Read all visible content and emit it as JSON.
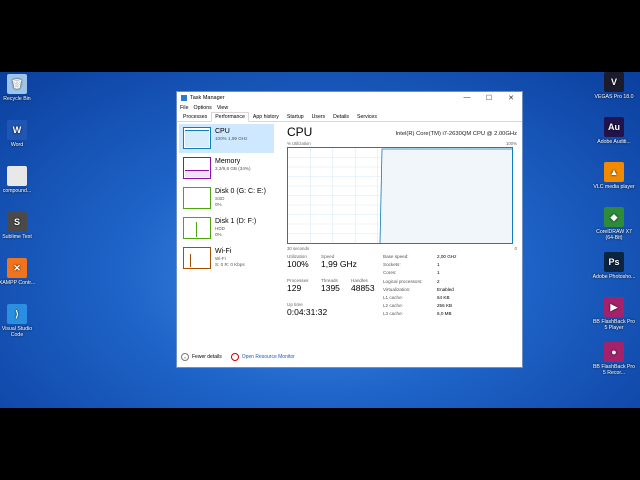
{
  "desktop": {
    "left_icons": [
      {
        "label": "Recycle Bin",
        "icon": "recycle-bin-icon",
        "color": "#9ec4e8",
        "glyph": "🗑"
      },
      {
        "label": "Word",
        "icon": "word-icon",
        "color": "#1f56b3",
        "glyph": "W"
      },
      {
        "label": "compound...",
        "icon": "document-icon",
        "color": "#e8e8e8",
        "glyph": ""
      },
      {
        "label": "Sublime Text",
        "icon": "sublime-icon",
        "color": "#4a4a4a",
        "glyph": "S"
      },
      {
        "label": "XAMPP Contr...",
        "icon": "xampp-icon",
        "color": "#f0741d",
        "glyph": "✕"
      },
      {
        "label": "Visual Studio Code",
        "icon": "vscode-icon",
        "color": "#2a8fe0",
        "glyph": "⟩"
      }
    ],
    "right_icons": [
      {
        "label": "VEGAS Pro 18.0",
        "icon": "vegas-pro-icon",
        "color": "#1b1b2e",
        "glyph": "V"
      },
      {
        "label": "Adobe Auditi...",
        "icon": "audition-icon",
        "color": "#23134d",
        "glyph": "Au"
      },
      {
        "label": "VLC media player",
        "icon": "vlc-icon",
        "color": "#f28a00",
        "glyph": "▲"
      },
      {
        "label": "CorelDRAW X7 (64-Bit)",
        "icon": "coreldraw-icon",
        "color": "#2e8b3a",
        "glyph": "◆"
      },
      {
        "label": "Adobe Photosho...",
        "icon": "photoshop-icon",
        "color": "#0d2541",
        "glyph": "Ps"
      },
      {
        "label": "BB FlashBack Pro 5 Player",
        "icon": "flashback-player-icon",
        "color": "#a3226b",
        "glyph": "▶"
      },
      {
        "label": "BB FlashBack Pro 5 Recor...",
        "icon": "flashback-recorder-icon",
        "color": "#a3226b",
        "glyph": "●"
      }
    ]
  },
  "window": {
    "title": "Task Manager",
    "controls": {
      "minimize": "—",
      "maximize": "☐",
      "close": "✕"
    },
    "menu": [
      "File",
      "Options",
      "View"
    ],
    "tabs": [
      "Processes",
      "Performance",
      "App history",
      "Startup",
      "Users",
      "Details",
      "Services"
    ],
    "active_tab": "Performance"
  },
  "sidebar": [
    {
      "name": "CPU",
      "line1": "100% 1,99 GHz",
      "line2": "",
      "line3": "",
      "color": "#117dbb"
    },
    {
      "name": "Memory",
      "line1": "3,3/9,8 GB (34%)",
      "line2": "",
      "line3": "",
      "color": "#8b12ae"
    },
    {
      "name": "Disk 0 (G: C: E:)",
      "line1": "SSD",
      "line2": "0%",
      "line3": "",
      "color": "#4da60c"
    },
    {
      "name": "Disk 1 (D: F:)",
      "line1": "HDD",
      "line2": "0%",
      "line3": "",
      "color": "#4da60c"
    },
    {
      "name": "Wi-Fi",
      "line1": "Wi-Fi",
      "line2": "S: 0 R: 0 Kbps",
      "line3": "",
      "color": "#a74f01"
    }
  ],
  "main": {
    "title": "CPU",
    "model": "Intel(R) Core(TM) i7-2630QM CPU @ 2.00GHz",
    "y_label": "% Utilization",
    "y_max": "100%",
    "x_label": "30 seconds",
    "x_min": "0",
    "utilization_label": "Utilization",
    "utilization": "100%",
    "speed_label": "Speed",
    "speed": "1,99 GHz",
    "processes_label": "Processes",
    "processes": "129",
    "threads_label": "Threads",
    "threads": "1395",
    "handles_label": "Handles",
    "handles": "48853",
    "uptime_label": "Up time",
    "uptime": "0:04:31:32",
    "details": [
      {
        "k": "Base speed:",
        "v": "2,00 GHz"
      },
      {
        "k": "Sockets:",
        "v": "1"
      },
      {
        "k": "Cores:",
        "v": "1"
      },
      {
        "k": "Logical processors:",
        "v": "2"
      },
      {
        "k": "Virtualization:",
        "v": "Enabled"
      },
      {
        "k": "L1 cache:",
        "v": "64 KB"
      },
      {
        "k": "L2 cache:",
        "v": "256 KB"
      },
      {
        "k": "L3 cache:",
        "v": "6,0 MB"
      }
    ]
  },
  "footer": {
    "fewer_details": "Fewer details",
    "open_monitor": "Open Resource Monitor"
  }
}
